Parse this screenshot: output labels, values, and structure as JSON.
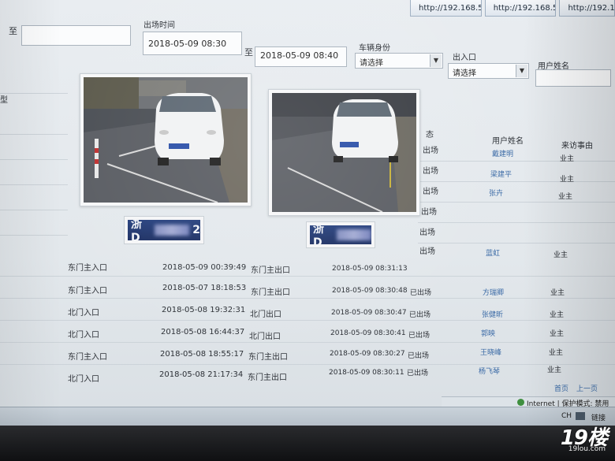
{
  "browser": {
    "tabs": [
      {
        "label": "http://192.168.5.10..."
      },
      {
        "label": "http://192.168.5.10..."
      },
      {
        "label": "http://192.16..."
      }
    ]
  },
  "filters": {
    "to_separator_1": "至",
    "exit_time_label": "出场时间",
    "exit_time_from": "2018-05-09 08:30",
    "to_separator_2": "至",
    "exit_time_to": "2018-05-09 08:40",
    "vehicle_identity_label": "车辆身份",
    "vehicle_identity_value": "请选择",
    "gate_label": "出入口",
    "gate_value": "请选择",
    "user_name_label": "用户姓名",
    "user_name_value": ""
  },
  "left_panel": {
    "header_fragment": "型"
  },
  "images": {
    "plate_prefix_1": "浙D",
    "plate_tail_1": "2",
    "plate_prefix_2": "浙D"
  },
  "right_table": {
    "col_state_fragment": "态",
    "col_user_name": "用户姓名",
    "col_visit_reason": "来访事由",
    "rows": [
      {
        "state": "出场",
        "name": "戴建明",
        "reason": "业主"
      },
      {
        "state": "出场",
        "name": "梁建平",
        "reason": "业主"
      },
      {
        "state": "出场",
        "name": "张卉",
        "reason": "业主"
      },
      {
        "state": "出场",
        "name": "",
        "reason": ""
      },
      {
        "state": "出场",
        "name": "",
        "reason": ""
      },
      {
        "state": "出场",
        "name": "蓝虹",
        "reason": "业主"
      }
    ]
  },
  "main_table": {
    "rows": [
      {
        "entry_gate": "东门主入口",
        "entry_time": "2018-05-09 00:39:49",
        "exit_gate": "东门主出口",
        "exit_time": "2018-05-09 08:31:13",
        "state": "",
        "name": "",
        "reason": ""
      },
      {
        "entry_gate": "东门主入口",
        "entry_time": "2018-05-07 18:18:53",
        "exit_gate": "东门主出口",
        "exit_time": "2018-05-09 08:30:48",
        "state": "已出场",
        "name": "方瑞卿",
        "reason": "业主"
      },
      {
        "entry_gate": "北门入口",
        "entry_time": "2018-05-08 19:32:31",
        "exit_gate": "北门出口",
        "exit_time": "2018-05-09 08:30:47",
        "state": "已出场",
        "name": "张健昕",
        "reason": "业主"
      },
      {
        "entry_gate": "北门入口",
        "entry_time": "2018-05-08 16:44:37",
        "exit_gate": "北门出口",
        "exit_time": "2018-05-09 08:30:41",
        "state": "已出场",
        "name": "郭映",
        "reason": "业主"
      },
      {
        "entry_gate": "东门主入口",
        "entry_time": "2018-05-08 18:55:17",
        "exit_gate": "东门主出口",
        "exit_time": "2018-05-09 08:30:27",
        "state": "已出场",
        "name": "王晓峰",
        "reason": "业主"
      },
      {
        "entry_gate": "北门入口",
        "entry_time": "2018-05-08 21:17:34",
        "exit_gate": "东门主出口",
        "exit_time": "2018-05-09 08:30:11",
        "state": "已出场",
        "name": "杨飞琴",
        "reason": "业主"
      }
    ]
  },
  "pager": {
    "first": "首页",
    "prev": "上一页"
  },
  "statusbar": {
    "zone": "Internet | 保护模式: 禁用",
    "ime": "CH",
    "power": "链接"
  },
  "watermark": {
    "logo": "19楼",
    "url": "19lou.com"
  },
  "colors": {
    "accent": "#3a6aa6",
    "plate_blue": "#1c2f63"
  }
}
